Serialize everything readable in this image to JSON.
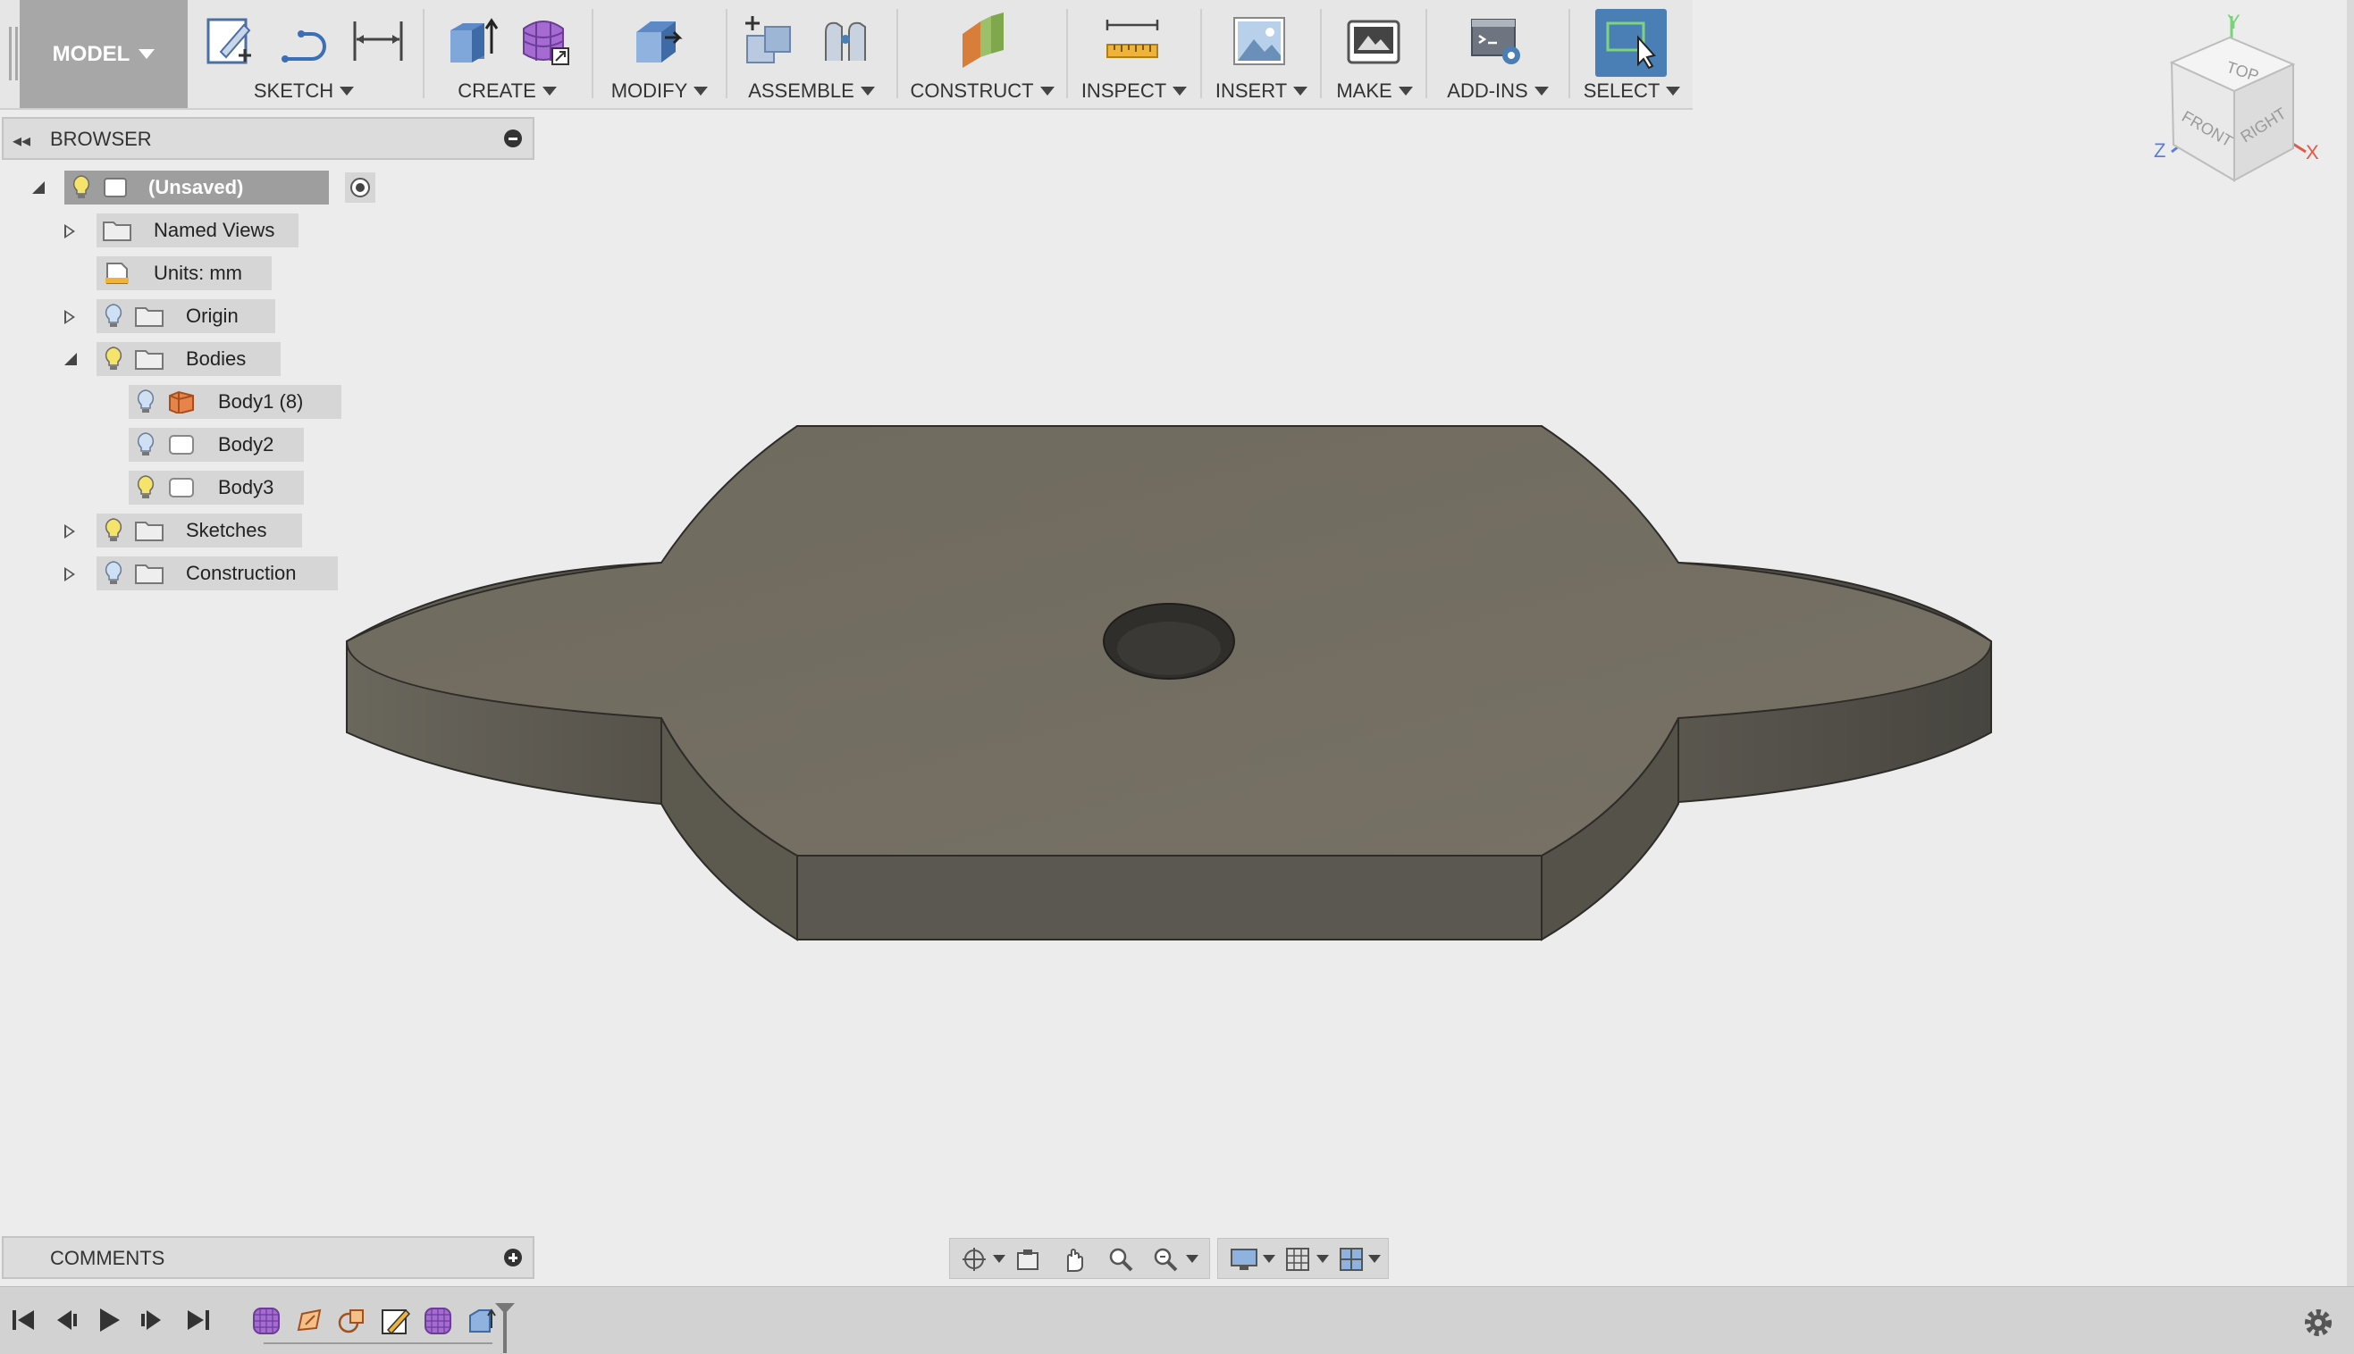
{
  "toolbar": {
    "workspace": "MODEL",
    "groups": [
      "SKETCH",
      "CREATE",
      "MODIFY",
      "ASSEMBLE",
      "CONSTRUCT",
      "INSPECT",
      "INSERT",
      "MAKE",
      "ADD-INS",
      "SELECT"
    ]
  },
  "browser": {
    "title": "BROWSER",
    "root": "(Unsaved)",
    "items": {
      "named_views": "Named Views",
      "units": "Units: mm",
      "origin": "Origin",
      "bodies": "Bodies",
      "body1": "Body1 (8)",
      "body2": "Body2",
      "body3": "Body3",
      "sketches": "Sketches",
      "construction": "Construction"
    }
  },
  "comments": {
    "title": "COMMENTS"
  },
  "viewcube": {
    "top": "TOP",
    "front": "FRONT",
    "right": "RIGHT",
    "axis_x": "X",
    "axis_y": "Y",
    "axis_z": "Z"
  },
  "colors": {
    "part_top": "#6f6a5e",
    "part_side": "#55524a",
    "selected_select_tool": "#4a7fb5",
    "body1_icon": "#e8834a"
  }
}
